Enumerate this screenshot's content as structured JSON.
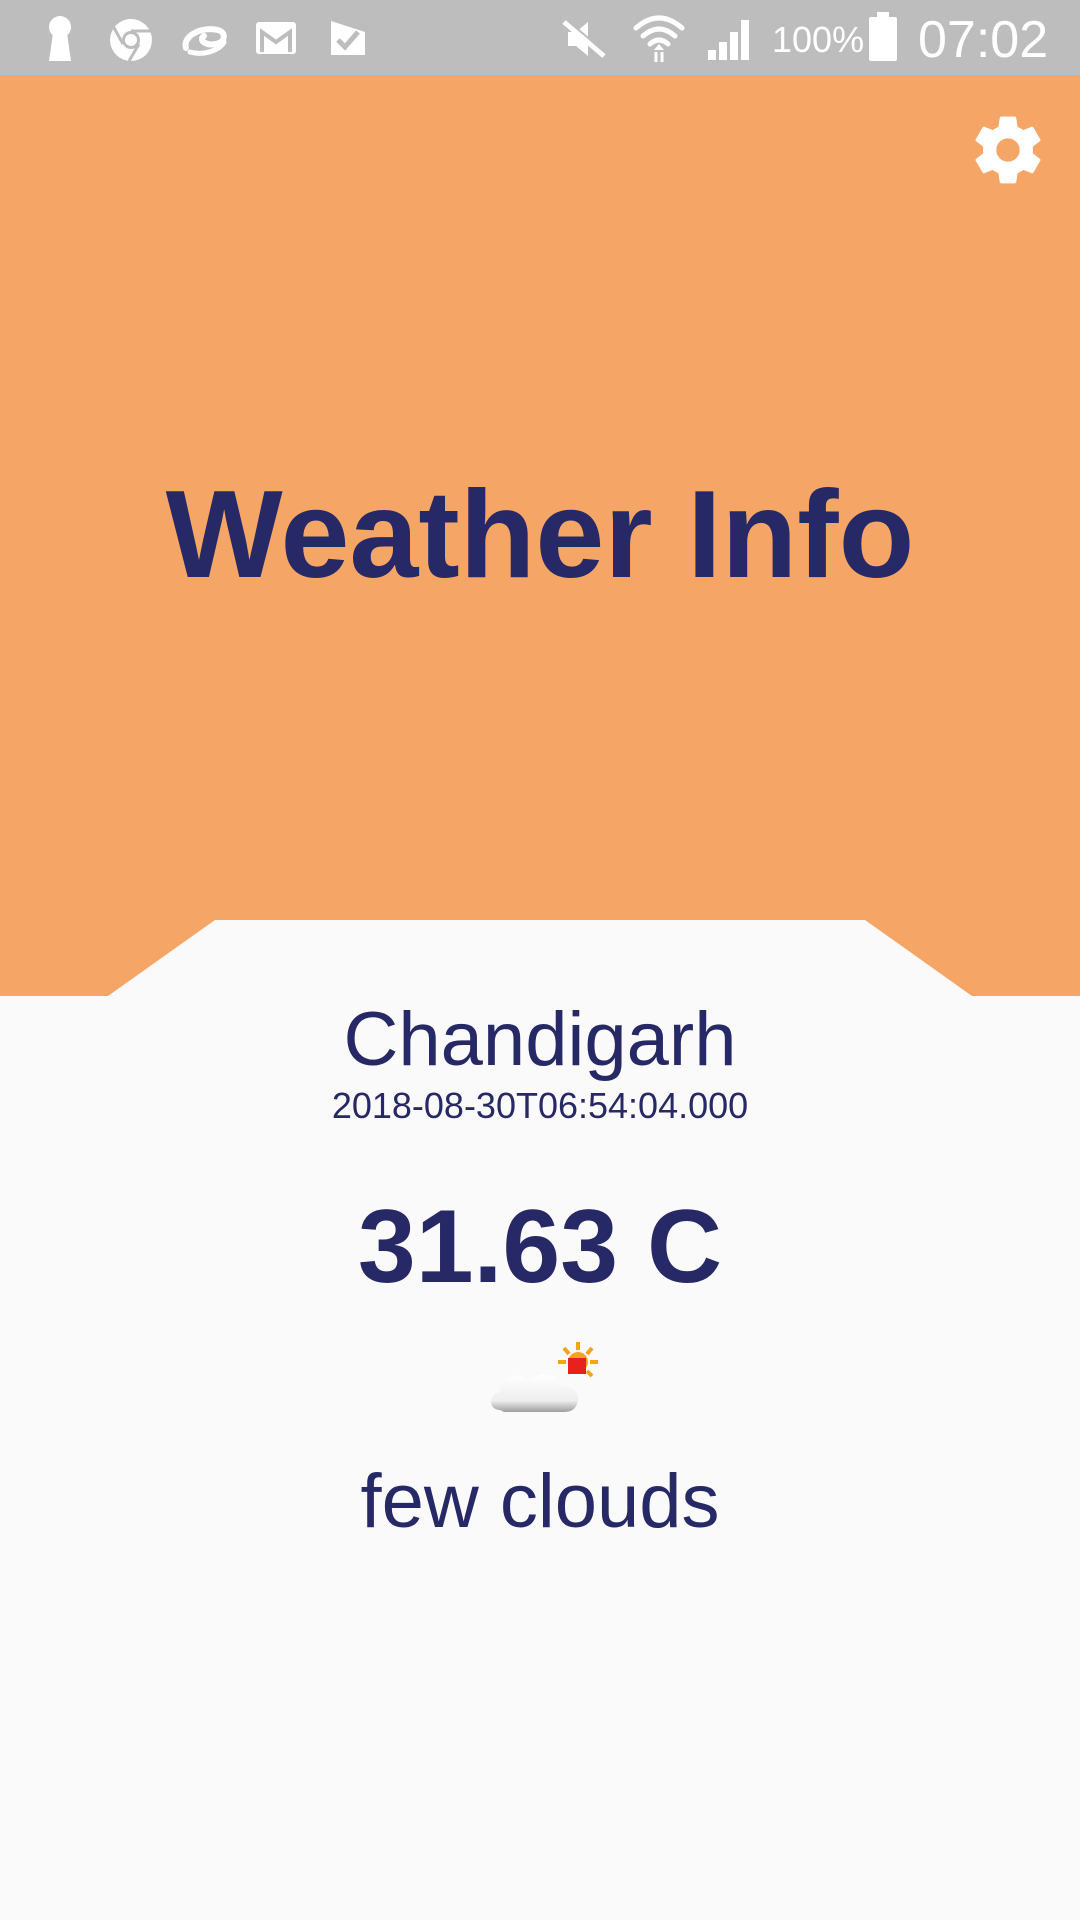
{
  "status_bar": {
    "battery": "100%",
    "time": "07:02",
    "icons": [
      "keyhole-icon",
      "chrome-icon",
      "swirl-app-icon",
      "gmail-icon",
      "checkmark-app-icon",
      "mute-icon",
      "wifi-icon",
      "signal-icon",
      "battery-icon"
    ]
  },
  "header": {
    "title": "Weather Info",
    "settings_icon": "gear-icon"
  },
  "weather": {
    "city": "Chandigarh",
    "timestamp": "2018-08-30T06:54:04.000",
    "temperature": "31.63 C",
    "condition_icon": "few-clouds-icon",
    "description": "few clouds"
  },
  "colors": {
    "status_bar": "#BDBDBD",
    "header": "#F5A666",
    "background": "#FAFAFA",
    "text": "#272966"
  }
}
